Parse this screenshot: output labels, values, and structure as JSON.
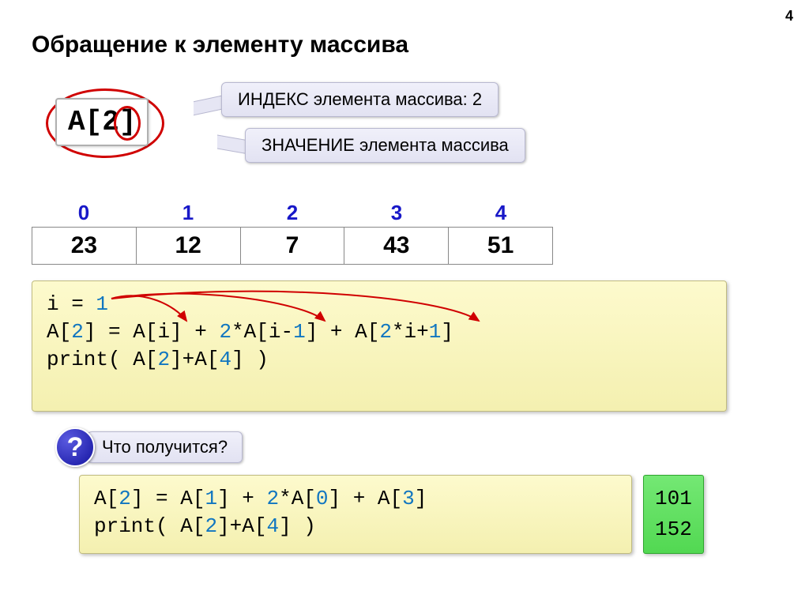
{
  "page_number": "4",
  "title": "Обращение к элементу массива",
  "element": {
    "a": "A[",
    "two": "2",
    "close": "]"
  },
  "bubbles": {
    "index": "ИНДЕКС элемента массива: 2",
    "value": "ЗНАЧЕНИЕ элемента массива"
  },
  "array": {
    "indices": [
      "0",
      "1",
      "2",
      "3",
      "4"
    ],
    "values": [
      "23",
      "12",
      "7",
      "43",
      "51"
    ]
  },
  "code_main": {
    "l1a": "i = ",
    "l1b": "1",
    "l2a": "A[",
    "l2b": "2",
    "l2c": "] = A[i] + ",
    "l2d": "2",
    "l2e": "*A[i-",
    "l2f": "1",
    "l2g": "] + A[",
    "l2h": "2",
    "l2i": "*i+",
    "l2j": "1",
    "l2k": "]",
    "l3a": "print( A[",
    "l3b": "2",
    "l3c": "]+A[",
    "l3d": "4",
    "l3e": "] )"
  },
  "question": {
    "mark": "?",
    "text": "Что получится?"
  },
  "code_sec": {
    "l1a": "A[",
    "l1b": "2",
    "l1c": "] = A[",
    "l1d": "1",
    "l1e": "] + ",
    "l1f": "2",
    "l1g": "*A[",
    "l1h": "0",
    "l1i": "] + A[",
    "l1j": "3",
    "l1k": "]",
    "l2a": "print( A[",
    "l2b": "2",
    "l2c": "]+A[",
    "l2d": "4",
    "l2e": "] )"
  },
  "results": [
    "101",
    "152"
  ]
}
